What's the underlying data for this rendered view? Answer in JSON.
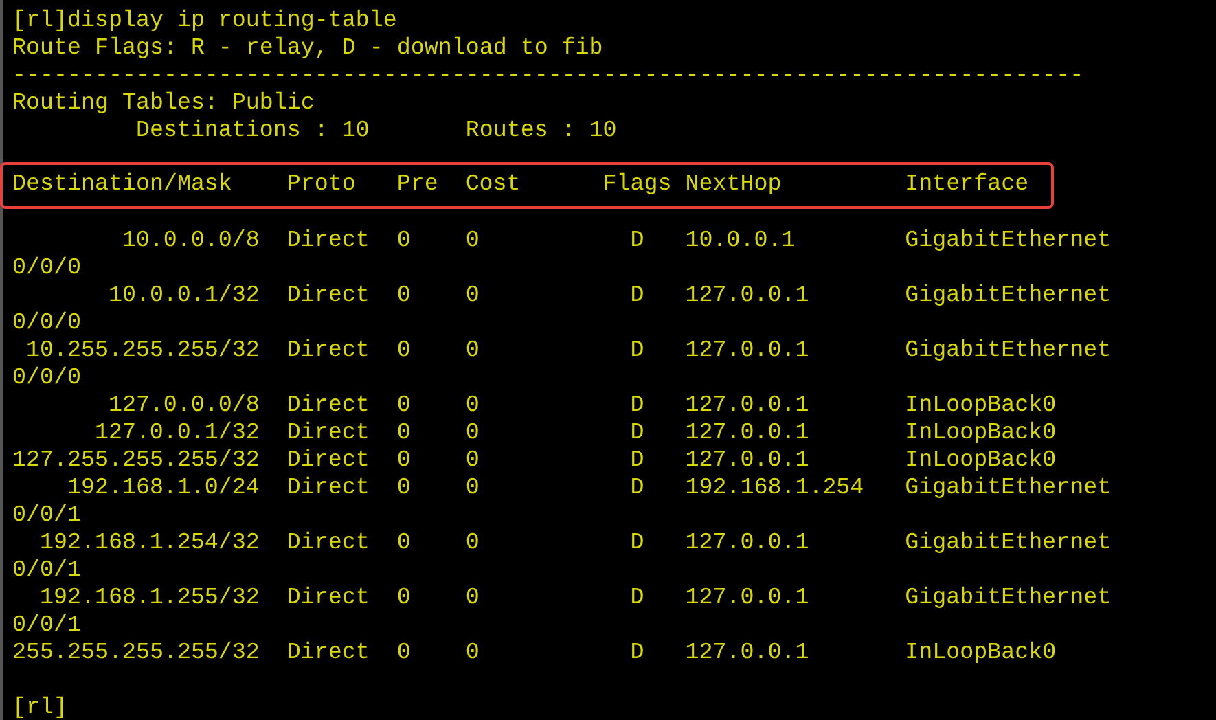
{
  "terminal": {
    "lines": [
      "[rl]display ip routing-table",
      "Route Flags: R - relay, D - download to fib",
      "------------------------------------------------------------------------------",
      "Routing Tables: Public",
      "         Destinations : 10       Routes : 10"
    ],
    "table": {
      "highlighted": true,
      "columns": [
        "Destination/Mask",
        "Proto",
        "Pre",
        "Cost",
        "Flags",
        "NextHop",
        "Interface"
      ],
      "rows": [
        {
          "destination": "10.0.0.0/8",
          "proto": "Direct",
          "pre": "0",
          "cost": "0",
          "flags": "D",
          "nexthop": "10.0.0.1",
          "interface": "GigabitEthernet",
          "interface_wrap": "0/0/0"
        },
        {
          "destination": "10.0.0.1/32",
          "proto": "Direct",
          "pre": "0",
          "cost": "0",
          "flags": "D",
          "nexthop": "127.0.0.1",
          "interface": "GigabitEthernet",
          "interface_wrap": "0/0/0"
        },
        {
          "destination": "10.255.255.255/32",
          "proto": "Direct",
          "pre": "0",
          "cost": "0",
          "flags": "D",
          "nexthop": "127.0.0.1",
          "interface": "GigabitEthernet",
          "interface_wrap": "0/0/0"
        },
        {
          "destination": "127.0.0.0/8",
          "proto": "Direct",
          "pre": "0",
          "cost": "0",
          "flags": "D",
          "nexthop": "127.0.0.1",
          "interface": "InLoopBack0"
        },
        {
          "destination": "127.0.0.1/32",
          "proto": "Direct",
          "pre": "0",
          "cost": "0",
          "flags": "D",
          "nexthop": "127.0.0.1",
          "interface": "InLoopBack0"
        },
        {
          "destination": "127.255.255.255/32",
          "proto": "Direct",
          "pre": "0",
          "cost": "0",
          "flags": "D",
          "nexthop": "127.0.0.1",
          "interface": "InLoopBack0"
        },
        {
          "destination": "192.168.1.0/24",
          "proto": "Direct",
          "pre": "0",
          "cost": "0",
          "flags": "D",
          "nexthop": "192.168.1.254",
          "interface": "GigabitEthernet",
          "interface_wrap": "0/0/1"
        },
        {
          "destination": "192.168.1.254/32",
          "proto": "Direct",
          "pre": "0",
          "cost": "0",
          "flags": "D",
          "nexthop": "127.0.0.1",
          "interface": "GigabitEthernet",
          "interface_wrap": "0/0/1"
        },
        {
          "destination": "192.168.1.255/32",
          "proto": "Direct",
          "pre": "0",
          "cost": "0",
          "flags": "D",
          "nexthop": "127.0.0.1",
          "interface": "GigabitEthernet",
          "interface_wrap": "0/0/1"
        },
        {
          "destination": "255.255.255.255/32",
          "proto": "Direct",
          "pre": "0",
          "cost": "0",
          "flags": "D",
          "nexthop": "127.0.0.1",
          "interface": "InLoopBack0"
        }
      ]
    },
    "prompt": "[rl]"
  }
}
